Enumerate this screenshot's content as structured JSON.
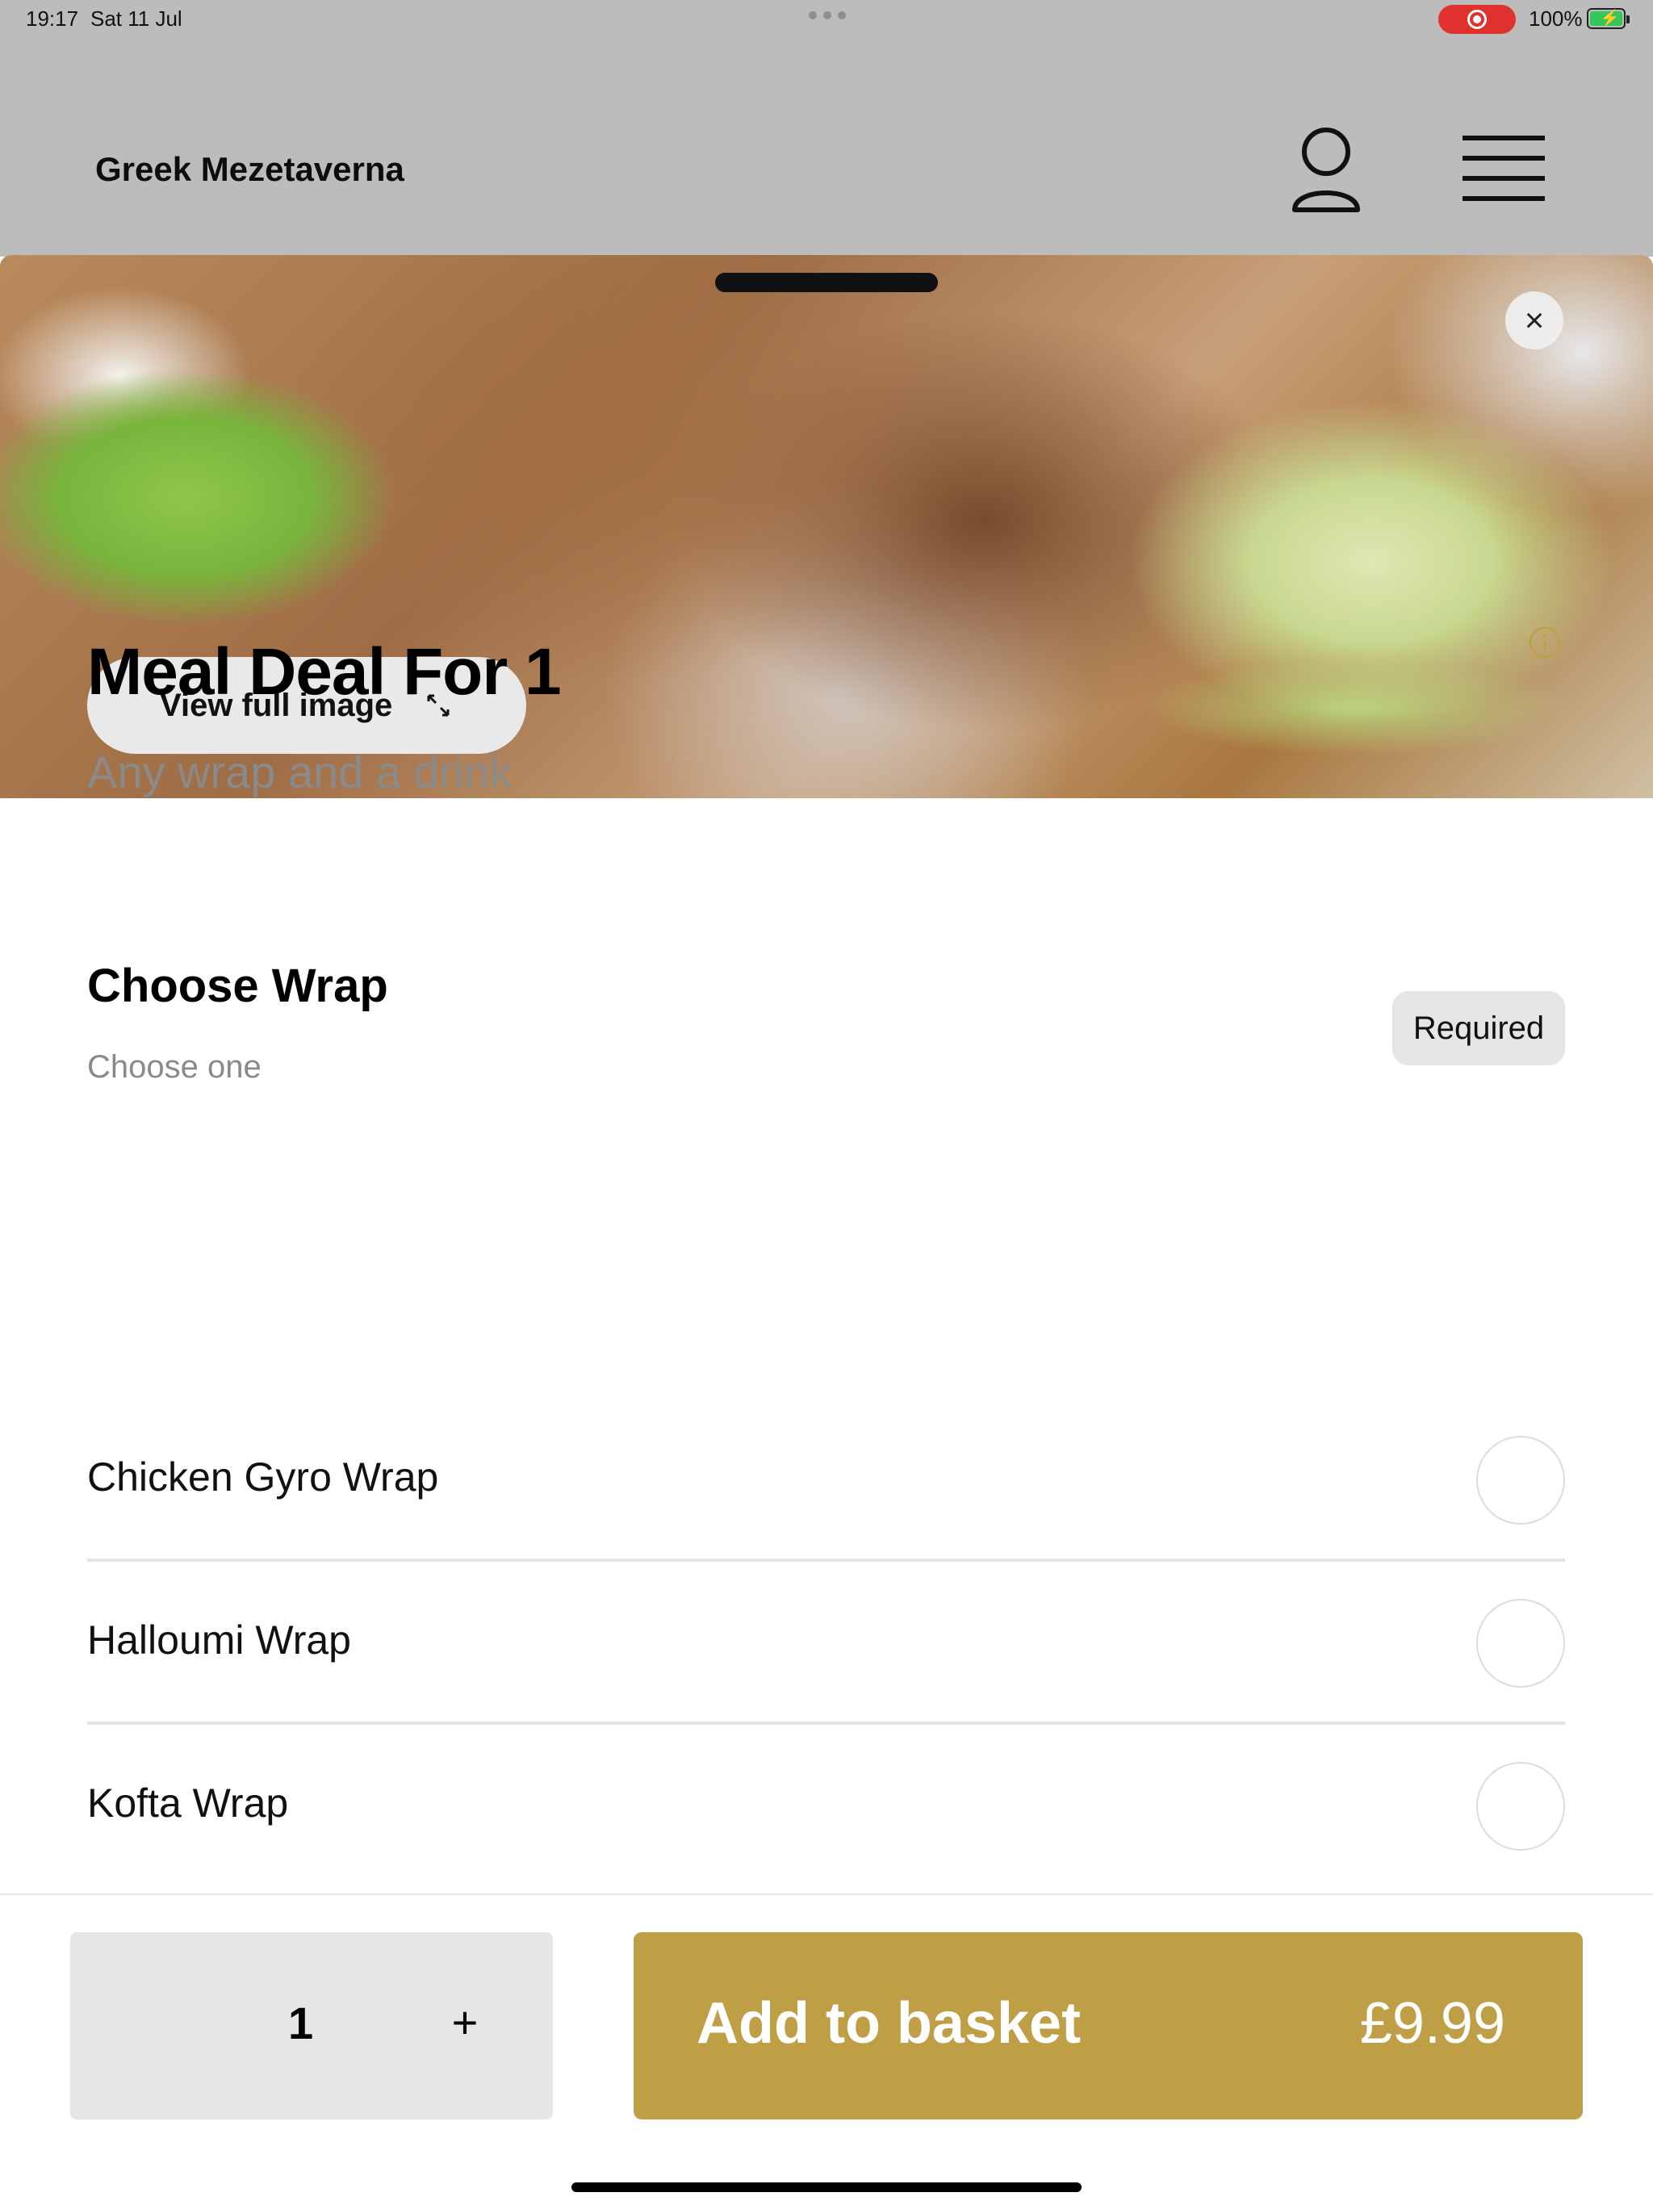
{
  "status_bar": {
    "time": "19:17",
    "date": "Sat 11 Jul",
    "battery": "100%",
    "record_icon": "screen-record-icon",
    "battery_icon": "battery-charging-icon"
  },
  "header": {
    "app_title": "Greek Mezetaverna",
    "account_icon": "person-icon",
    "menu_icon": "hamburger-menu-icon"
  },
  "item": {
    "view_full_image": "View full image",
    "title": "Meal Deal For 1",
    "description": "Any wrap and a drink"
  },
  "section": {
    "title": "Choose Wrap",
    "subtitle": "Choose one",
    "badge": "Required",
    "options": [
      {
        "label": "Chicken Gyro Wrap",
        "selected": false
      },
      {
        "label": "Halloumi Wrap",
        "selected": false
      },
      {
        "label": "Kofta Wrap",
        "selected": false
      }
    ]
  },
  "footer": {
    "quantity": "1",
    "increment": "+",
    "add_label": "Add to basket",
    "price": "£9.99"
  },
  "colors": {
    "accent": "#bf9f46",
    "backdrop": "#bcbcbc",
    "muted_text": "#8a8a8a"
  }
}
